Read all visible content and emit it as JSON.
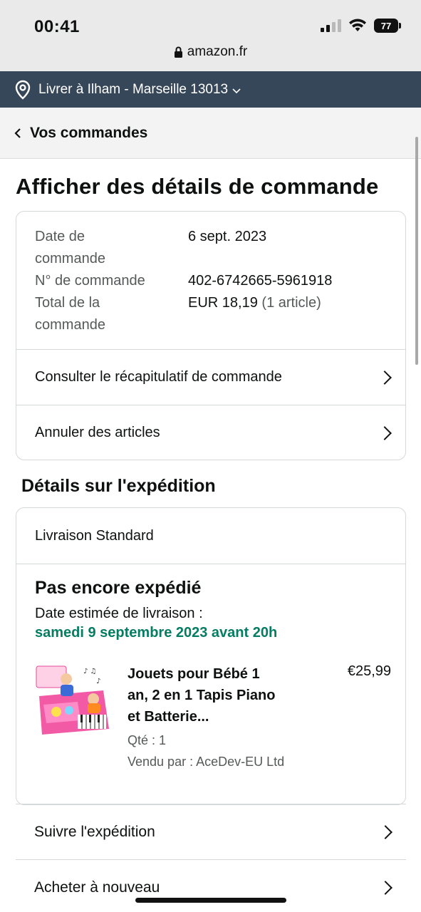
{
  "status_bar": {
    "time": "00:41",
    "battery": "77",
    "url": "amazon.fr"
  },
  "delivery": {
    "text": "Livrer à Ilham - Marseille 13013"
  },
  "nav": {
    "back_label": "Vos commandes"
  },
  "page": {
    "title": "Afficher des détails de commande"
  },
  "order": {
    "date_label_1": "Date de",
    "date_label_2": "commande",
    "date_value": "6 sept. 2023",
    "number_label": "N° de commande",
    "number_value": "402-6742665-5961918",
    "total_label_1": "Total de la",
    "total_label_2": "commande",
    "total_value": "EUR 18,19",
    "total_items": "(1 article)",
    "summary_link": "Consulter le récapitulatif de commande",
    "cancel_link": "Annuler des articles"
  },
  "shipment": {
    "section_title": "Détails sur l'expédition",
    "method": "Livraison Standard",
    "status": "Pas encore expédié",
    "est_label": "Date estimée de livraison :",
    "est_date": "samedi 9 septembre 2023 avant 20h",
    "product": {
      "title_1": "Jouets pour Bébé 1",
      "title_2": "an, 2 en 1 Tapis Piano",
      "title_3": "et Batterie...",
      "price": "€25,99",
      "qty": "Qté : 1",
      "seller": "Vendu par : AceDev-EU Ltd"
    }
  },
  "actions": {
    "track": "Suivre l'expédition",
    "buy_again": "Acheter à nouveau"
  },
  "colors": {
    "delivery_bar": "#37475a",
    "success_green": "#067d62"
  }
}
